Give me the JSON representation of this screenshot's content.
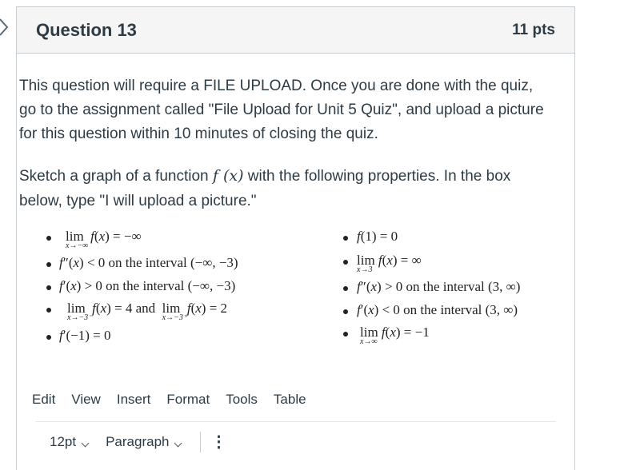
{
  "question": {
    "title": "Question 13",
    "points": "11 pts",
    "paragraph1": "This question will require a FILE UPLOAD. Once you are done with the quiz, go to the assignment called \"File Upload for Unit 5 Quiz\", and upload a picture for this question within 10 minutes of closing the quiz.",
    "paragraph2_before": "Sketch a graph of a function ",
    "paragraph2_math": "f (x)",
    "paragraph2_after": " with the following properties. In the box below, type \"I will upload a picture.\""
  },
  "properties_left": [
    {
      "text": "lim  f(x) = −∞",
      "sub": "x→−∞"
    },
    {
      "text": "f″(x) < 0 on the interval (−∞, −3)",
      "sub": ""
    },
    {
      "text": "f′(x) > 0 on the interval (−∞, −3)",
      "sub": ""
    },
    {
      "text": "lim  f(x) = 4 and  lim  f(x) = 2",
      "sub": "x→−3⁻",
      "sub2": "x→−3⁺"
    },
    {
      "text": "f′(−1) = 0",
      "sub": ""
    }
  ],
  "properties_right": [
    {
      "text": "f(1) = 0",
      "sub": ""
    },
    {
      "text": "lim f(x) = ∞",
      "sub": "x→3"
    },
    {
      "text": "f″(x) > 0 on the interval (3, ∞)",
      "sub": ""
    },
    {
      "text": "f′(x) < 0 on the interval (3, ∞)",
      "sub": ""
    },
    {
      "text": "lim f(x) = −1",
      "sub": "x→∞"
    }
  ],
  "editor": {
    "menu": [
      "Edit",
      "View",
      "Insert",
      "Format",
      "Tools",
      "Table"
    ],
    "font_size": "12pt",
    "block_format": "Paragraph"
  }
}
